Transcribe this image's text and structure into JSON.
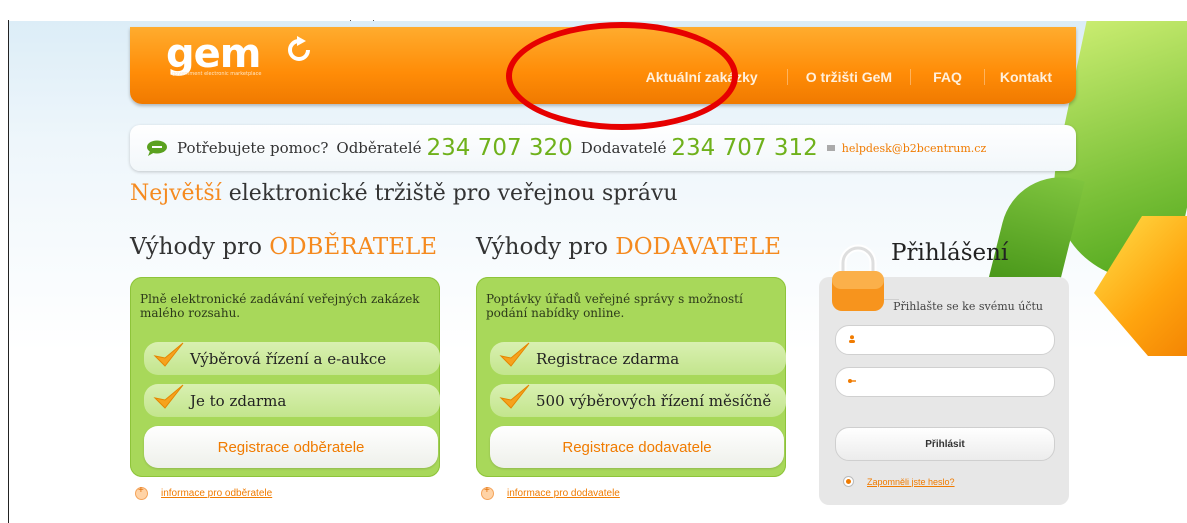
{
  "header": {
    "logo_text": "gem",
    "logo_sub": "government electronic marketplace",
    "nav": [
      "Aktuální zakázky",
      "O tržišti GeM",
      "FAQ",
      "Kontakt"
    ]
  },
  "help": {
    "question": "Potřebujete pomoc?",
    "buyers_label": "Odběratelé",
    "buyers_phone": "234 707 320",
    "suppliers_label": "Dodavatelé",
    "suppliers_phone": "234 707 312",
    "email": "helpdesk@b2bcentrum.cz"
  },
  "tagline": {
    "highlight": "Největší",
    "rest": " elektronické tržiště pro veřejnou správu"
  },
  "buyers": {
    "title_prefix": "Výhody pro ",
    "title_highlight": "ODBĚRATELE",
    "description": "Plně elektronické zadávání veřejných zakázek malého rozsahu.",
    "items": [
      "Výběrová řízení a e-aukce",
      "Je to zdarma"
    ],
    "button": "Registrace odběratele",
    "info_link": "informace pro odběratele"
  },
  "suppliers": {
    "title_prefix": "Výhody pro ",
    "title_highlight": "DODAVATELE",
    "description": "Poptávky úřadů veřejné správy s možností podání nabídky online.",
    "items": [
      "Registrace zdarma",
      "500 výběrových řízení měsíčně"
    ],
    "button": "Registrace dodavatele",
    "info_link": "informace pro dodavatele"
  },
  "login": {
    "title": "Přihlášení",
    "subtitle": "Přihlašte se ke svému účtu",
    "username_value": "",
    "password_value": "",
    "button": "Přihlásit",
    "forgot": "Zapomněli jste heslo?"
  },
  "colors": {
    "header_orange": "#ff8c07",
    "accent_orange": "#f58a1f",
    "phone_green": "#6fb11b",
    "box_green": "#a8d85a",
    "annotation_red": "#e60000"
  }
}
